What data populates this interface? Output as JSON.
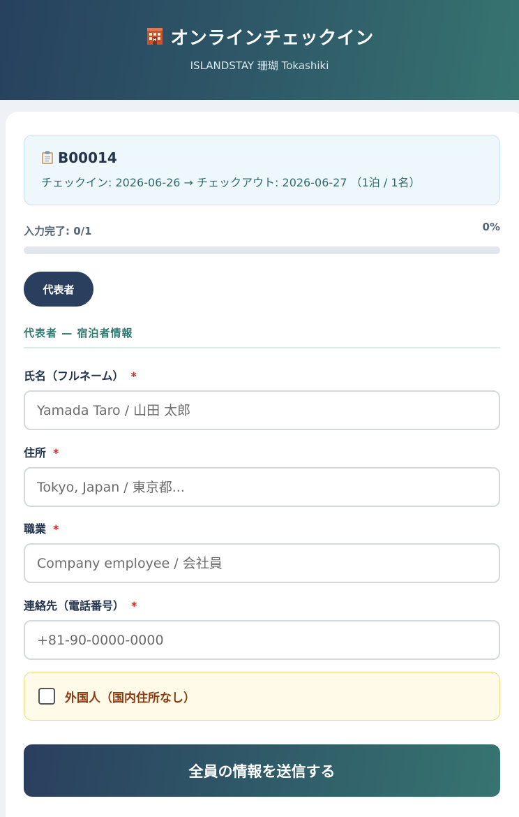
{
  "header": {
    "title": "オンラインチェックイン",
    "subtitle": "ISLANDSTAY 珊瑚 Tokashiki",
    "icon": "hotel-icon"
  },
  "booking": {
    "icon": "clipboard-icon",
    "id": "B00014",
    "dates": "チェックイン: 2026-06-26 → チェックアウト: 2026-06-27 （1泊 / 1名）"
  },
  "progress": {
    "label": "入力完了: 0/1",
    "percent_text": "0%",
    "fraction": 0
  },
  "tabs": [
    {
      "label": "代表者",
      "active": true
    }
  ],
  "section": {
    "title": "代表者 — 宿泊者情報"
  },
  "fields": {
    "name": {
      "label": "氏名（フルネーム）",
      "required": "*",
      "placeholder": "Yamada Taro / 山田 太郎",
      "value": ""
    },
    "address": {
      "label": "住所",
      "required": "*",
      "placeholder": "Tokyo, Japan / 東京都...",
      "value": ""
    },
    "occupation": {
      "label": "職業",
      "required": "*",
      "placeholder": "Company employee / 会社員",
      "value": ""
    },
    "phone": {
      "label": "連絡先（電話番号）",
      "required": "*",
      "placeholder": "+81-90-0000-0000",
      "value": ""
    }
  },
  "foreigner": {
    "label": "外国人（国内住所なし）",
    "checked": false
  },
  "submit": {
    "label": "全員の情報を送信する"
  },
  "colors": {
    "header_start": "#27415e",
    "header_end": "#377470",
    "required": "#d02828",
    "section_title": "#2f7a70",
    "foreign_text": "#8a3a10"
  }
}
